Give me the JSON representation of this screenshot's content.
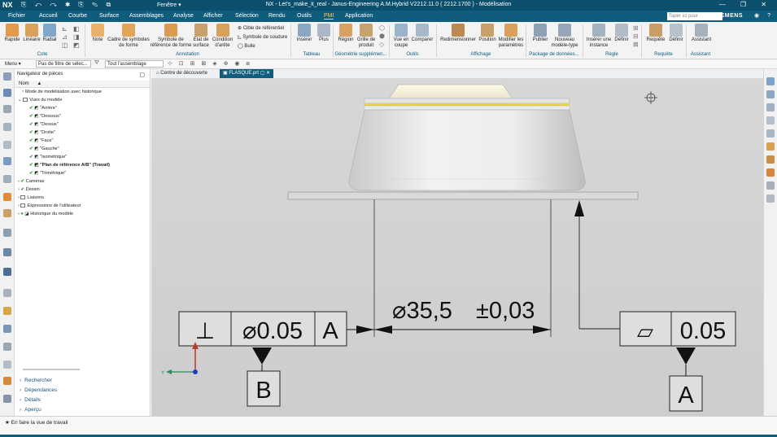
{
  "app": {
    "logo": "NX",
    "window_menu": "Fenêtre ▾",
    "title": "NX - Let's_make_it_real - Janus-Engineering A.M.Hybrid V2212.11.0 ( 2212.1700 ) - Modélisation"
  },
  "menubar": {
    "tabs": [
      "Fichier",
      "Accueil",
      "Courbe",
      "Surface",
      "Assemblages",
      "Analyse",
      "Afficher",
      "Sélection",
      "Rendu",
      "Outils",
      "PMI",
      "Application"
    ],
    "active_tab": "PMI",
    "search_placeholder": "Taper ici pour rechercher",
    "brand": "SIEMENS"
  },
  "ribbon": {
    "buttons": [
      {
        "label": "Rapide",
        "icon": "rapid-dimension-icon"
      },
      {
        "label": "Linéaire",
        "icon": "linear-dimension-icon"
      },
      {
        "label": "Radial",
        "icon": "radial-dimension-icon"
      },
      {
        "label": "Note",
        "icon": "note-icon"
      },
      {
        "label": "Cadre de symboles de forme",
        "icon": "feature-control-frame-icon"
      },
      {
        "label": "Symbole de référence de forme",
        "icon": "datum-feature-symbol-icon"
      },
      {
        "label": "Etat de surface",
        "icon": "surface-finish-icon"
      },
      {
        "label": "Condition d'arête",
        "icon": "edge-condition-icon"
      },
      {
        "label": "Insérer",
        "icon": "insert-table-icon"
      },
      {
        "label": "Plus",
        "icon": "more-icon"
      },
      {
        "label": "Région",
        "icon": "region-icon"
      },
      {
        "label": "Grille de produit",
        "icon": "product-grid-icon"
      },
      {
        "label": "Vue en coupe",
        "icon": "section-view-icon"
      },
      {
        "label": "Comparer",
        "icon": "compare-icon"
      },
      {
        "label": "Redimensionner",
        "icon": "resize-icon"
      },
      {
        "label": "Position",
        "icon": "position-icon"
      },
      {
        "label": "Modifier les paramètres",
        "icon": "edit-settings-icon"
      },
      {
        "label": "Publier",
        "icon": "publish-icon"
      },
      {
        "label": "Nouveau modèle-type",
        "icon": "new-template-icon"
      },
      {
        "label": "Insérer une instance",
        "icon": "insert-instance-icon"
      },
      {
        "label": "Définir",
        "icon": "define-rule-icon"
      },
      {
        "label": "Requête",
        "icon": "query-icon"
      },
      {
        "label": "Définir",
        "icon": "define-query-icon"
      },
      {
        "label": "Assistant",
        "icon": "assistant-icon"
      }
    ],
    "annotation_small": [
      "Cible de référentiel",
      "Symbole de soudure",
      "Bulle"
    ],
    "groups": [
      "Cote",
      "Annotation",
      "Tableau",
      "Géométrie supplémen...",
      "Outils",
      "Affichage",
      "Package de données...",
      "Règle",
      "Requête",
      "Assistant"
    ]
  },
  "toolbar": {
    "menu_label": "Menu ▾",
    "filter_value": "Pas de filtre de sélec...",
    "scope_value": "Tout l'assemblage"
  },
  "doc_tabs": [
    {
      "label": "Centre de découverte"
    },
    {
      "label": "FLASQUE.prt"
    }
  ],
  "navigator": {
    "title": "Navigateur de pièces",
    "column": "Nom",
    "items": [
      {
        "label": "Mode de modélisation avec historique"
      },
      {
        "label": "Vues du modèle"
      },
      {
        "label": "\"Arrière\""
      },
      {
        "label": "\"Dessous\""
      },
      {
        "label": "\"Dessus\""
      },
      {
        "label": "\"Droite\""
      },
      {
        "label": "\"Face\""
      },
      {
        "label": "\"Gauche\""
      },
      {
        "label": "\"Isométrique\""
      },
      {
        "label": "\"Plan de référence A/B\" (Travail)"
      },
      {
        "label": "\"Trimétrique\""
      },
      {
        "label": "Caméras"
      },
      {
        "label": "Dessin"
      },
      {
        "label": "Liaisons"
      },
      {
        "label": "Expressions de l'utilisateur"
      },
      {
        "label": "Historique du modèle"
      }
    ],
    "bottom_panels": [
      "Rechercher",
      "Dépendances",
      "Détails",
      "Aperçu"
    ]
  },
  "pmi": {
    "fcf_left": {
      "symbol": "⊥",
      "tolerance": "⌀0.05",
      "datum": "A"
    },
    "fcf_right": {
      "symbol": "▱",
      "tolerance": "0.05"
    },
    "dimension": {
      "value": "⌀35,5",
      "tolerance": "±0,03"
    },
    "datum_b": "B",
    "datum_a": "A"
  },
  "status": {
    "message": "En faire la vue de travail"
  },
  "colors": {
    "brand_blue": "#0f5c7d",
    "active_tab": "#ffd24d",
    "viewport_bg": "#d3d3d3",
    "yellow_band": "#e6d53a"
  }
}
